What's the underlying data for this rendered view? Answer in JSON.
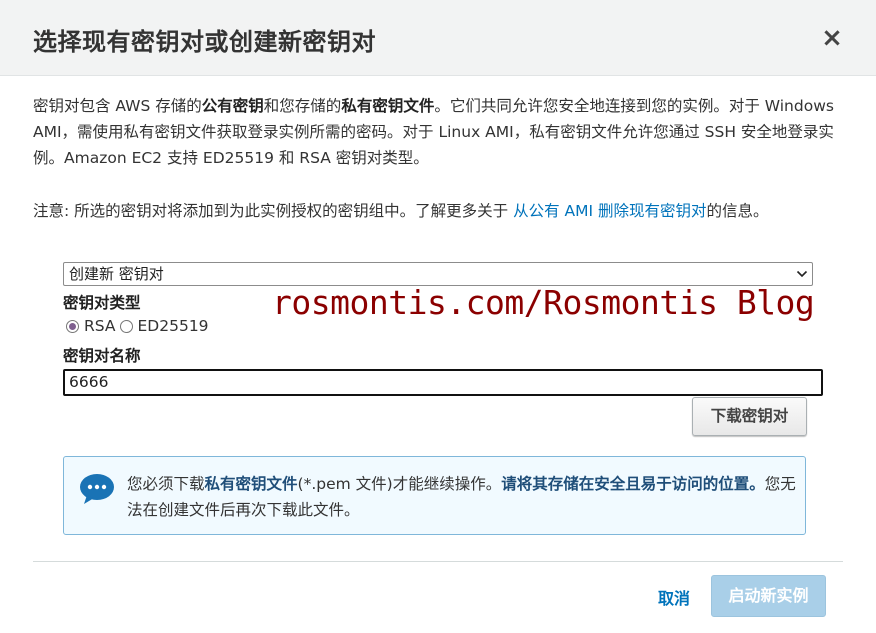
{
  "dialog": {
    "title": "选择现有密钥对或创建新密钥对",
    "close_glyph": "×"
  },
  "intro": {
    "p1": "密钥对包含 AWS 存储的",
    "b1": "公有密钥",
    "p2": "和您存储的",
    "b2": "私有密钥文件",
    "p3": "。它们共同允许您安全地连接到您的实例。对于 Windows AMI，需使用私有密钥文件获取登录实例所需的密码。对于 Linux AMI，私有密钥文件允许您通过 SSH 安全地登录实例。Amazon EC2 支持 ED25519 和 RSA 密钥对类型。"
  },
  "note": {
    "text": "注意: 所选的密钥对将添加到为此实例授权的密钥组中。了解更多关于 ",
    "link": "从公有 AMI 删除现有密钥对",
    "suffix": "的信息。"
  },
  "keypair_select": {
    "selected": "创建新 密钥对",
    "chevron": "⌄"
  },
  "key_type": {
    "label": "密钥对类型",
    "options": [
      "RSA",
      "ED25519"
    ],
    "selected": "RSA"
  },
  "key_name": {
    "label": "密钥对名称",
    "value": "6666"
  },
  "download_button": "下载密钥对",
  "info": {
    "t1": "您必须下载",
    "b1": "私有密钥文件",
    "t2": "(*.pem 文件)才能继续操作。",
    "b2": "请将其存储在安全且易于访问的位置。",
    "t3": "您无法在创建文件后再次下载此文件。"
  },
  "footer": {
    "cancel": "取消",
    "launch": "启动新实例"
  },
  "watermark": "rosmontis.com/Rosmontis Blog",
  "colors": {
    "link": "#0073bb",
    "launch_disabled": "#a9cfe8",
    "info_border": "#7fb7da",
    "info_bg": "#f1faff",
    "watermark": "#8b0000"
  }
}
